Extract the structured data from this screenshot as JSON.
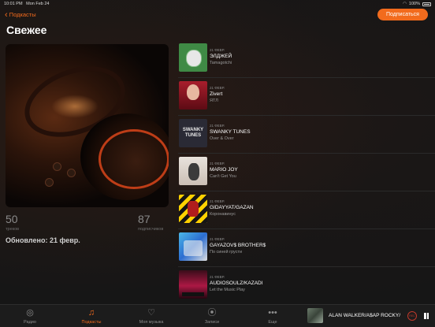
{
  "status": {
    "time": "10:01 PM",
    "date": "Mon Feb 24",
    "battery": "100%"
  },
  "nav": {
    "back_label": "Подкасты",
    "subscribe_label": "Подписаться"
  },
  "page": {
    "title": "Свежее"
  },
  "stats": {
    "tracks_count": "50",
    "tracks_label": "треков",
    "subscribers_count": "87",
    "subscribers_label": "подписчиков",
    "updated": "Обновлено: 21 февр."
  },
  "episodes": [
    {
      "date": "21 ФЕВР.",
      "artist": "ЭЛДЖЕЙ",
      "track": "Tamagotchi"
    },
    {
      "date": "21 ФЕВР.",
      "artist": "Zivert",
      "track": "ЯТЛ"
    },
    {
      "date": "21 ФЕВР.",
      "artist": "SWANKY TUNES",
      "track": "Over & Over",
      "cover_text": "SWANKY TUNES"
    },
    {
      "date": "21 ФЕВР.",
      "artist": "MARIO JOY",
      "track": "Can't Get You"
    },
    {
      "date": "21 ФЕВР.",
      "artist": "GIDAYYAT/GAZAN",
      "track": "Коронавинус"
    },
    {
      "date": "21 ФЕВР.",
      "artist": "GAYAZOV$ BROTHER$",
      "track": "По синей грусти"
    },
    {
      "date": "21 ФЕВР.",
      "artist": "AUDIOSOULZ/KAZADI",
      "track": "Let the Music Play"
    }
  ],
  "tabs": [
    {
      "label": "Радио",
      "icon": "radio-icon"
    },
    {
      "label": "Подкасты",
      "icon": "podcast-icon",
      "active": true
    },
    {
      "label": "Моя музыка",
      "icon": "heart-icon"
    },
    {
      "label": "Записи",
      "icon": "record-icon"
    },
    {
      "label": "Еще",
      "icon": "more-icon"
    }
  ],
  "now_playing": {
    "title": "ALAN WALKER/A$AP ROCKY/",
    "rec_label": "REC"
  },
  "colors": {
    "accent": "#f26b1d",
    "background": "#161616"
  }
}
